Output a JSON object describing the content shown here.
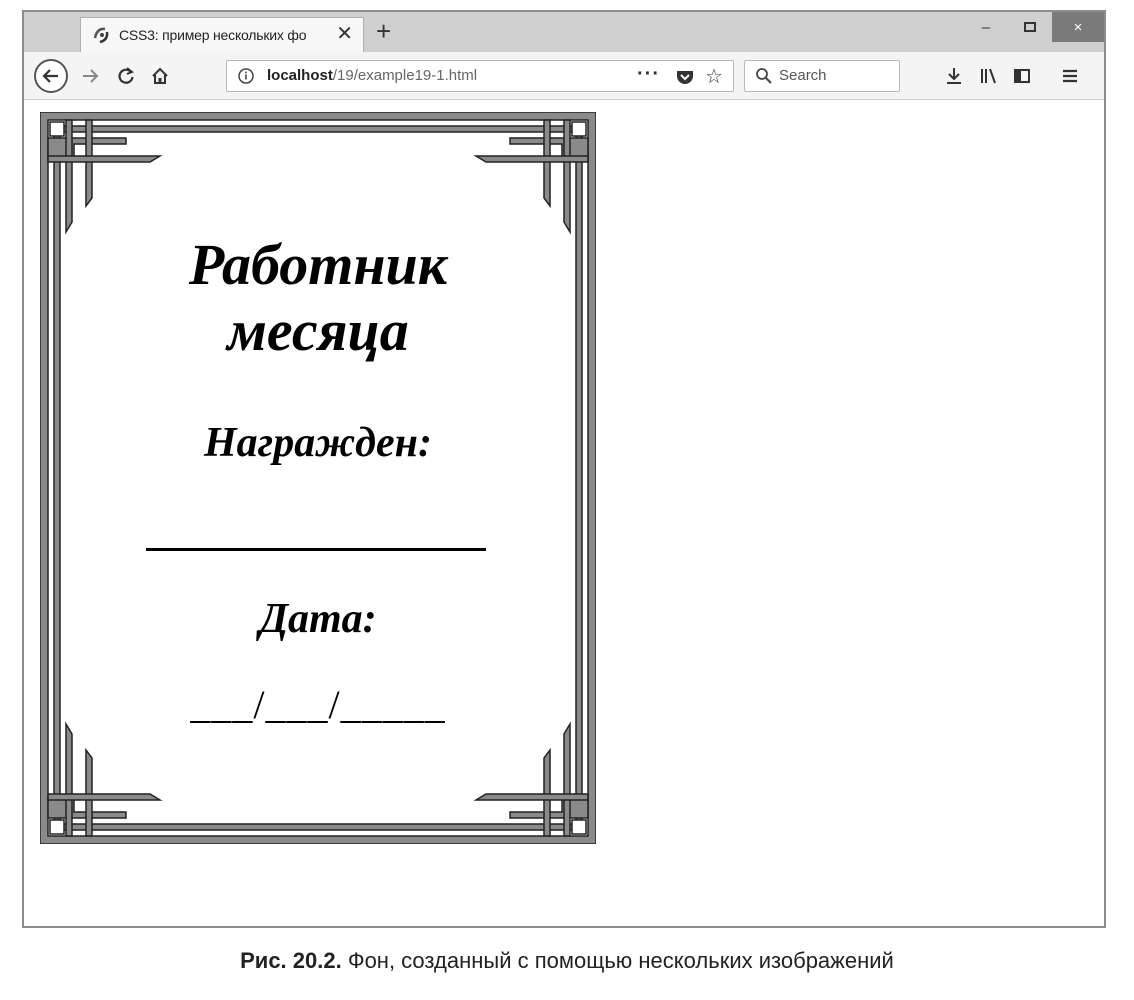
{
  "browser": {
    "tab_title": "CSS3: пример нескольких фо",
    "tab_close": "✕",
    "new_tab": "+",
    "url_host": "localhost",
    "url_path": "/19/example19-1.html",
    "url_more": "···",
    "search_placeholder": "Search",
    "window_minimize": "–",
    "window_close": "×"
  },
  "certificate": {
    "title_line1": "Работник",
    "title_line2": "месяца",
    "awarded_label": "Награжден:",
    "date_label": "Дата:",
    "date_template": "___/___/_____"
  },
  "caption": {
    "label": "Рис. 20.2.",
    "text": "Фон, созданный с помощью нескольких изображений"
  },
  "colors": {
    "frame_fill": "#8a8a8a",
    "frame_edge": "#222222",
    "close_button": "#7a7a7a"
  }
}
